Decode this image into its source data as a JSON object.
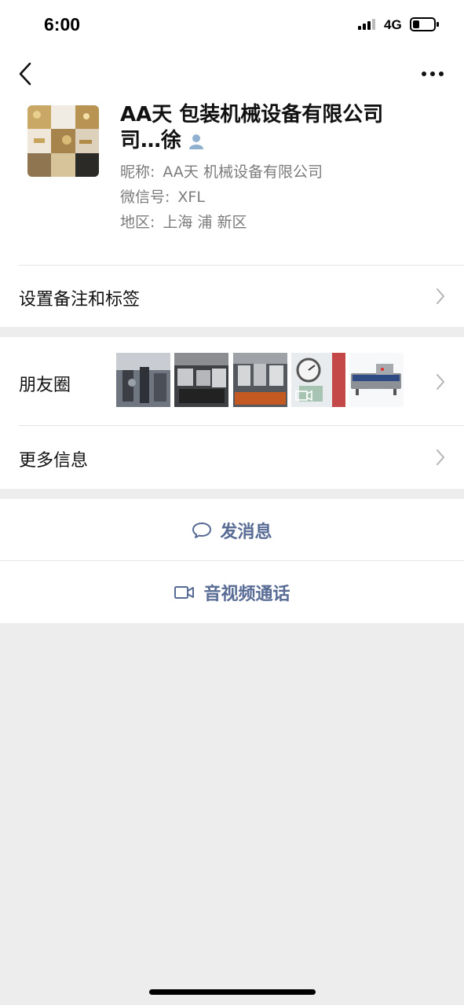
{
  "status_bar": {
    "time": "6:00",
    "network": "4G",
    "battery_level": 0.3
  },
  "nav": {
    "back_icon": "chevron-left-icon",
    "more_icon": "more-dots-icon"
  },
  "profile": {
    "name_line1": "AA天 包装机械设备有限公司",
    "name_line2": "司…徐",
    "nickname_label": "昵称:",
    "nickname_value": "AA天 机械设备有限公司",
    "wechat_id_label": "微信号:",
    "wechat_id_value": "XFL",
    "region_label": "地区:",
    "region_value": "上海 浦 新区"
  },
  "rows": {
    "remark": "设置备注和标签",
    "moments": "朋友圈",
    "more_info": "更多信息"
  },
  "actions": {
    "message": "发消息",
    "video_call": "音视频通话"
  },
  "colors": {
    "accent": "#576b95",
    "background": "#ededed"
  }
}
